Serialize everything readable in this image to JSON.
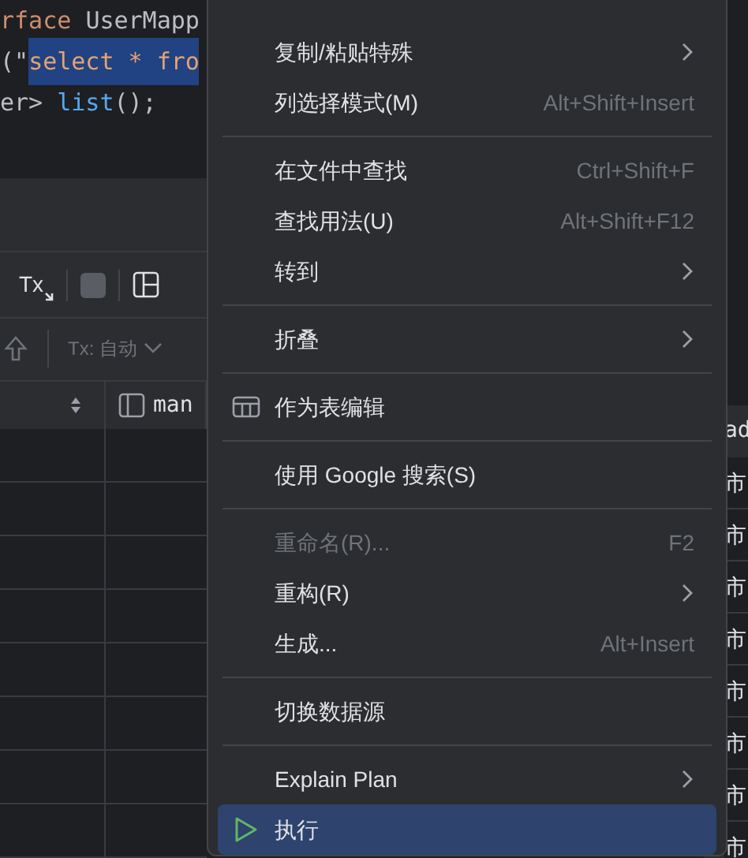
{
  "editor": {
    "lines": [
      {
        "segments": [
          {
            "text": "rface ",
            "kind": "keyword",
            "selected": false
          },
          {
            "text": "UserMapp",
            "kind": "plain",
            "selected": false
          }
        ]
      },
      {
        "segments": [
          {
            "text": "(\"",
            "kind": "plain",
            "selected": false
          },
          {
            "text": "select * fro",
            "kind": "sql",
            "selected": true
          }
        ]
      },
      {
        "segments": [
          {
            "text": "er> ",
            "kind": "plain",
            "selected": false
          },
          {
            "text": "list",
            "kind": "method",
            "selected": false
          },
          {
            "text": "();",
            "kind": "plain",
            "selected": false
          }
        ]
      }
    ]
  },
  "toolbar": {
    "transaction_label": "Tx"
  },
  "results": {
    "tx_mode": "Tx: 自动",
    "columns": [
      {
        "sortable": true
      },
      {
        "label": "man",
        "sortable": false
      }
    ]
  },
  "side_table": {
    "header": "ad",
    "cells": [
      "市",
      "市",
      "市",
      "市",
      "市",
      "市",
      "市",
      "市"
    ]
  },
  "context_menu": {
    "items": [
      {
        "kind": "item",
        "label": "复制/粘贴特殊",
        "submenu": true,
        "disabled": false,
        "selected": false
      },
      {
        "kind": "item",
        "label": "列选择模式(M)",
        "shortcut": "Alt+Shift+Insert",
        "submenu": false,
        "disabled": false,
        "selected": false
      },
      {
        "kind": "separator"
      },
      {
        "kind": "item",
        "label": "在文件中查找",
        "shortcut": "Ctrl+Shift+F",
        "submenu": false,
        "disabled": false,
        "selected": false
      },
      {
        "kind": "item",
        "label": "查找用法(U)",
        "shortcut": "Alt+Shift+F12",
        "submenu": false,
        "disabled": false,
        "selected": false
      },
      {
        "kind": "item",
        "label": "转到",
        "submenu": true,
        "disabled": false,
        "selected": false
      },
      {
        "kind": "separator"
      },
      {
        "kind": "item",
        "label": "折叠",
        "submenu": true,
        "disabled": false,
        "selected": false
      },
      {
        "kind": "separator"
      },
      {
        "kind": "table_item",
        "label": "作为表编辑",
        "submenu": false,
        "disabled": false,
        "selected": false
      },
      {
        "kind": "separator"
      },
      {
        "kind": "item",
        "label": "使用 Google 搜索(S)",
        "submenu": false,
        "disabled": false,
        "selected": false
      },
      {
        "kind": "separator"
      },
      {
        "kind": "item",
        "label": "重命名(R)...",
        "shortcut": "F2",
        "submenu": false,
        "disabled": true,
        "selected": false
      },
      {
        "kind": "item",
        "label": "重构(R)",
        "submenu": true,
        "disabled": false,
        "selected": false
      },
      {
        "kind": "item",
        "label": "生成...",
        "shortcut": "Alt+Insert",
        "submenu": false,
        "disabled": false,
        "selected": false
      },
      {
        "kind": "separator"
      },
      {
        "kind": "item",
        "label": "切换数据源",
        "submenu": false,
        "disabled": false,
        "selected": false
      },
      {
        "kind": "separator"
      },
      {
        "kind": "item",
        "label": "Explain Plan",
        "submenu": true,
        "disabled": false,
        "selected": false
      },
      {
        "kind": "run_item",
        "label": "执行",
        "submenu": false,
        "disabled": false,
        "selected": true
      }
    ]
  }
}
